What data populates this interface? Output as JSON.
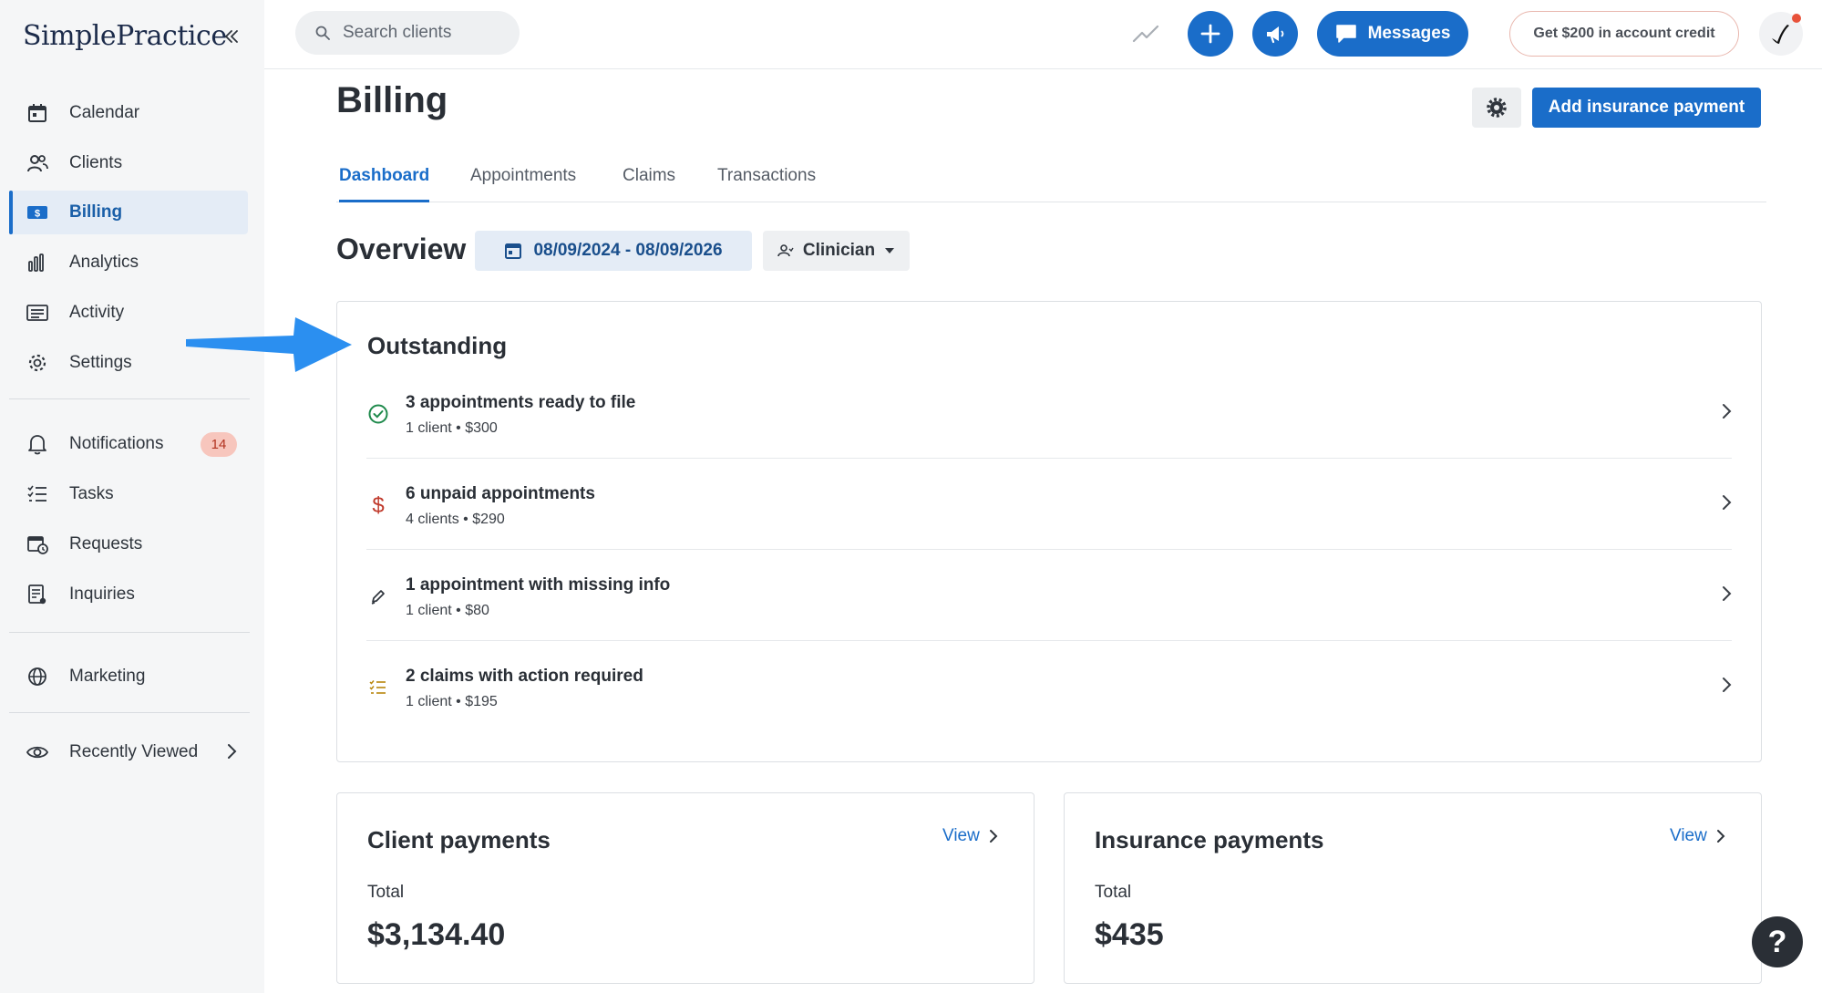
{
  "app": {
    "logo": "SimplePractice"
  },
  "sidebar": {
    "items": [
      {
        "label": "Calendar",
        "icon": "calendar-icon"
      },
      {
        "label": "Clients",
        "icon": "clients-icon"
      },
      {
        "label": "Billing",
        "icon": "billing-icon",
        "active": true
      },
      {
        "label": "Analytics",
        "icon": "analytics-icon"
      },
      {
        "label": "Activity",
        "icon": "activity-icon"
      },
      {
        "label": "Settings",
        "icon": "settings-icon"
      },
      {
        "label": "Notifications",
        "icon": "bell-icon",
        "badge": "14"
      },
      {
        "label": "Tasks",
        "icon": "tasks-icon"
      },
      {
        "label": "Requests",
        "icon": "requests-icon"
      },
      {
        "label": "Inquiries",
        "icon": "inquiries-icon"
      },
      {
        "label": "Marketing",
        "icon": "globe-icon"
      },
      {
        "label": "Recently Viewed",
        "icon": "eye-icon"
      }
    ]
  },
  "topbar": {
    "search_placeholder": "Search clients",
    "messages_label": "Messages",
    "credit_label": "Get $200 in account credit"
  },
  "page": {
    "title": "Billing",
    "primary_action": "Add insurance payment",
    "tabs": [
      "Dashboard",
      "Appointments",
      "Claims",
      "Transactions"
    ],
    "active_tab": "Dashboard"
  },
  "overview": {
    "title": "Overview",
    "date_range": "08/09/2024 - 08/09/2026",
    "clinician_filter": "Clinician"
  },
  "outstanding": {
    "title": "Outstanding",
    "rows": [
      {
        "title": "3 appointments ready to file",
        "sub": "1 client  •  $300",
        "icon": "check-circle-icon"
      },
      {
        "title": "6 unpaid appointments",
        "sub": "4 clients  •  $290",
        "icon": "dollar-icon"
      },
      {
        "title": "1 appointment with missing info",
        "sub": "1 client  •  $80",
        "icon": "pencil-icon"
      },
      {
        "title": "2 claims with action required",
        "sub": "1 client  •  $195",
        "icon": "list-check-icon"
      }
    ]
  },
  "client_payments": {
    "title": "Client payments",
    "view": "View",
    "total_label": "Total",
    "total": "$3,134.40"
  },
  "insurance_payments": {
    "title": "Insurance payments",
    "view": "View",
    "total_label": "Total",
    "total": "$435"
  },
  "help": {
    "label": "?"
  },
  "colors": {
    "accent": "#1a6dc9",
    "annotation_arrow": "#2b8ff0",
    "badge": "#f7c6bd"
  }
}
